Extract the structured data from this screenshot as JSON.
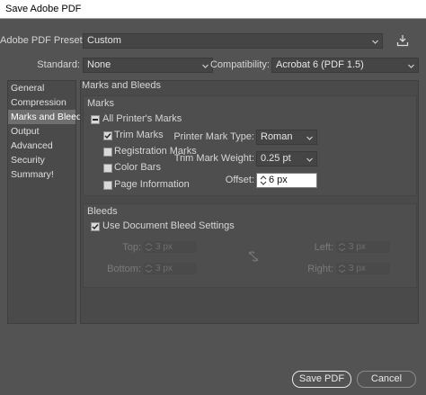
{
  "window": {
    "title": "Save Adobe PDF"
  },
  "preset": {
    "label": "Adobe PDF Preset:",
    "value": "Custom"
  },
  "standard": {
    "label": "Standard:",
    "value": "None"
  },
  "compatibility": {
    "label": "Compatibility:",
    "value": "Acrobat 6 (PDF 1.5)"
  },
  "sidebar": {
    "items": [
      {
        "label": "General",
        "selected": false
      },
      {
        "label": "Compression",
        "selected": false
      },
      {
        "label": "Marks and Bleeds",
        "selected": true
      },
      {
        "label": "Output",
        "selected": false
      },
      {
        "label": "Advanced",
        "selected": false
      },
      {
        "label": "Security",
        "selected": false
      },
      {
        "label": "Summary!",
        "selected": false
      }
    ]
  },
  "panel": {
    "title": "Marks and Bleeds"
  },
  "marks": {
    "header": "Marks",
    "all_printers_marks": {
      "label": "All Printer's Marks",
      "checked": "indeterminate"
    },
    "trim_marks": {
      "label": "Trim Marks",
      "checked": true
    },
    "registration_marks": {
      "label": "Registration Marks",
      "checked": false
    },
    "color_bars": {
      "label": "Color Bars",
      "checked": false
    },
    "page_information": {
      "label": "Page Information",
      "checked": false
    },
    "printer_mark_type": {
      "label": "Printer Mark Type:",
      "value": "Roman"
    },
    "trim_mark_weight": {
      "label": "Trim Mark Weight:",
      "value": "0.25 pt"
    },
    "offset": {
      "label": "Offset:",
      "value": "6 px"
    }
  },
  "bleeds": {
    "header": "Bleeds",
    "use_document_bleed": {
      "label": "Use Document Bleed Settings",
      "checked": true
    },
    "top": {
      "label": "Top:",
      "value": "3 px"
    },
    "bottom": {
      "label": "Bottom:",
      "value": "3 px"
    },
    "left": {
      "label": "Left:",
      "value": "3 px"
    },
    "right": {
      "label": "Right:",
      "value": "3 px"
    }
  },
  "buttons": {
    "save": "Save PDF",
    "cancel": "Cancel"
  },
  "colors": {
    "background": "#535353",
    "panel": "#4a4a4a",
    "selection": "#6f6f6f"
  }
}
